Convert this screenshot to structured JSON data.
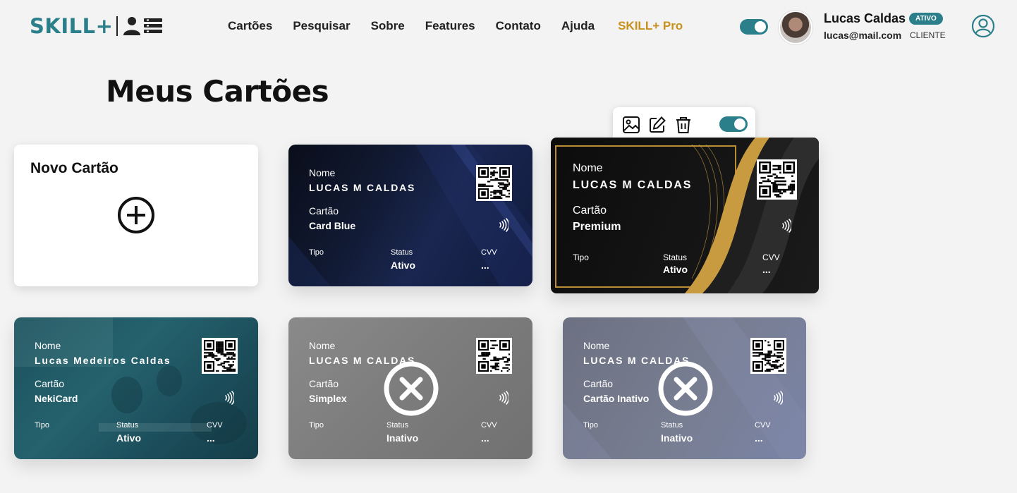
{
  "header": {
    "logo_text": "SKILL+",
    "nav": [
      "Cartões",
      "Pesquisar",
      "Sobre",
      "Features",
      "Contato",
      "Ajuda"
    ],
    "nav_pro": "SKILL+ Pro",
    "theme_toggle_on": true
  },
  "user": {
    "name": "Lucas Caldas",
    "status_badge": "ATIVO",
    "email": "lucas@mail.com",
    "role": "CLIENTE"
  },
  "page": {
    "title": "Meus Cartões",
    "new_card_label": "Novo Cartão"
  },
  "card_labels": {
    "name": "Nome",
    "card": "Cartão",
    "type": "Tipo",
    "status": "Status",
    "cvv": "CVV"
  },
  "cards": [
    {
      "holder": "LUCAS M CALDAS",
      "card_name": "Card Blue",
      "status": "Ativo",
      "cvv": "...",
      "theme": "blue",
      "active": true
    },
    {
      "holder": "LUCAS M CALDAS",
      "card_name": "Premium",
      "status": "Ativo",
      "cvv": "...",
      "theme": "premium",
      "active": true,
      "selected": true,
      "toggle_on": true
    },
    {
      "holder": "Lucas Medeiros Caldas",
      "card_name": "NekiCard",
      "status": "Ativo",
      "cvv": "...",
      "theme": "teal-photo",
      "active": true
    },
    {
      "holder": "LUCAS M CALDAS",
      "card_name": "Simplex",
      "status": "Inativo",
      "cvv": "...",
      "theme": "gray",
      "active": false
    },
    {
      "holder": "LUCAS M CALDAS",
      "card_name": "Cartão Inativo",
      "status": "Inativo",
      "cvv": "...",
      "theme": "slate",
      "active": false
    }
  ],
  "icons": {
    "image": "image-icon",
    "edit": "edit-icon",
    "delete": "trash-icon",
    "add": "plus-circle-icon",
    "inactive": "x-circle-icon",
    "nfc": "contactless-icon",
    "qr": "qr-code-icon",
    "account": "user-circle-icon"
  },
  "colors": {
    "brand": "#2a7f8a",
    "pro": "#c8911c",
    "background": "#f3f3f3"
  }
}
